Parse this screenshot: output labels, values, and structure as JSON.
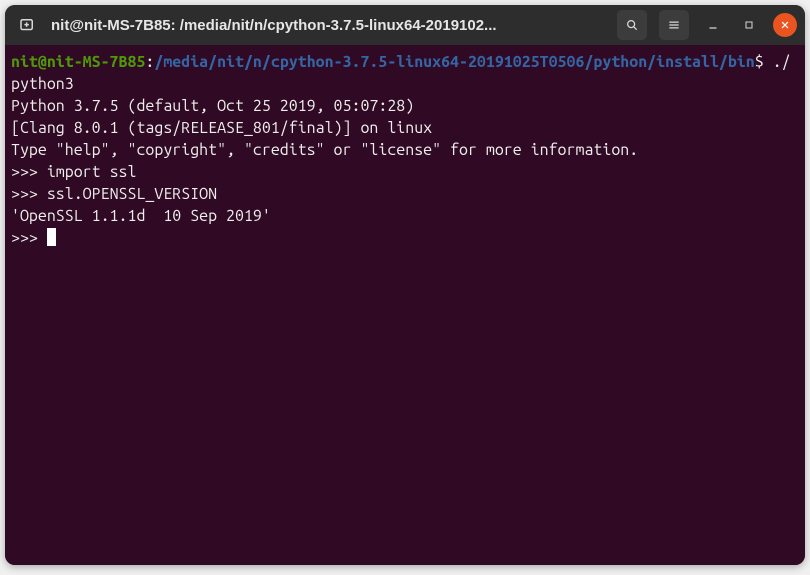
{
  "titlebar": {
    "title": "nit@nit-MS-7B85: /media/nit/n/cpython-3.7.5-linux64-2019102..."
  },
  "prompt": {
    "user_host": "nit@nit-MS-7B85",
    "colon": ":",
    "path": "/media/nit/n/cpython-3.7.5-linux64-20191025T0506/python/install/bin",
    "dollar": "$ ",
    "command": "./python3"
  },
  "output": {
    "line1": "Python 3.7.5 (default, Oct 25 2019, 05:07:28) ",
    "line2": "[Clang 8.0.1 (tags/RELEASE_801/final)] on linux",
    "line3": "Type \"help\", \"copyright\", \"credits\" or \"license\" for more information."
  },
  "repl": {
    "ps1_1": ">>> ",
    "cmd1": "import ssl",
    "ps1_2": ">>> ",
    "cmd2": "ssl.OPENSSL_VERSION",
    "result": "'OpenSSL 1.1.1d  10 Sep 2019'",
    "ps1_3": ">>> "
  }
}
